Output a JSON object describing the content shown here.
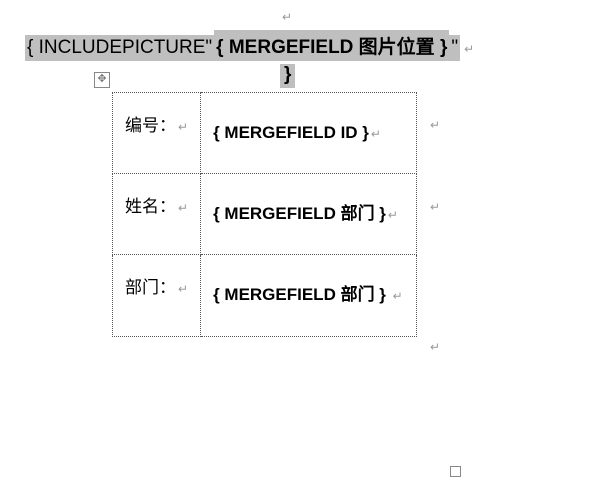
{
  "top_pilcrow": "↵",
  "header": {
    "seg1": "{ INCLUDEPICTURE\"",
    "seg2": "{ MERGEFIELD 图片位置 }",
    "seg3": "\"",
    "pilc": "↵"
  },
  "line2_brace": "}",
  "table_handle": "✥",
  "table": {
    "rows": [
      {
        "label": "编号：",
        "pilc_label": "↵",
        "value": "{ MERGEFIELD ID }",
        "pilc_val": "↵",
        "out_pilc": "↵"
      },
      {
        "label": "姓名：",
        "pilc_label": "↵",
        "value": "{ MERGEFIELD 部门 }",
        "pilc_val": "↵",
        "out_pilc": "↵"
      },
      {
        "label": "部门：",
        "pilc_label": "↵",
        "value": "{ MERGEFIELD 部门 }",
        "pilc_val": "↵",
        "out_pilc": "↵"
      }
    ]
  }
}
